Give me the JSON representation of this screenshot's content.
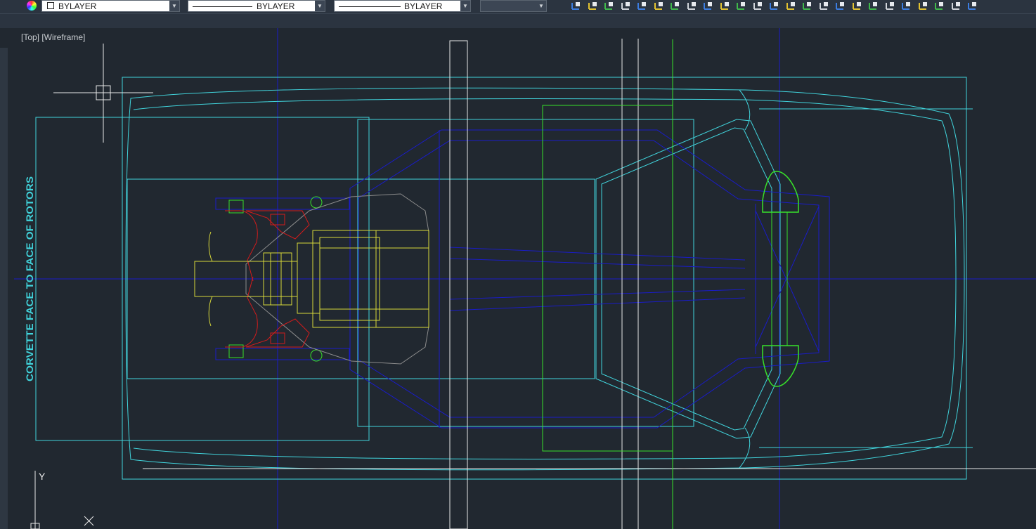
{
  "toolbar": {
    "color_control": {
      "value": "BYLAYER",
      "swatch_color": "#ffffff",
      "icon": "color-wheel-icon"
    },
    "linetype_control": {
      "value": "BYLAYER"
    },
    "lineweight_control": {
      "value": "BYLAYER"
    },
    "plotstyle_control": {
      "value": ""
    },
    "icons": [
      "ucs-icon",
      "ucs-icon",
      "ucs-icon",
      "named-ucs-icon",
      "view-icon",
      "view-icon",
      "view-icon",
      "ucs-x-icon",
      "ucs-y-icon",
      "ucs-z-icon",
      "ucs-3point-icon",
      "ucs-face-icon",
      "ucs-object-icon",
      "visibility-eye-icon",
      "cube-view-icon",
      "cube-view-icon",
      "cube-view-icon",
      "cube-view-icon",
      "cube-view-icon",
      "iso-view-icon",
      "iso-view-icon",
      "iso-view-icon",
      "iso-view-icon",
      "camera-icon",
      "render-icon"
    ]
  },
  "viewport": {
    "label": "[Top] [Wireframe]",
    "annotation_text": "CORVETTE FACE TO FACE OF ROTORS",
    "ucs_y_label": "Y",
    "colors": {
      "background": "#212830",
      "cyan": "#41d4dc",
      "blue": "#1a1cc8",
      "yellow": "#d8d83a",
      "red": "#d21c1c",
      "green": "#38e12a",
      "white": "#e8e8e8",
      "grey": "#8c8c8c"
    }
  }
}
